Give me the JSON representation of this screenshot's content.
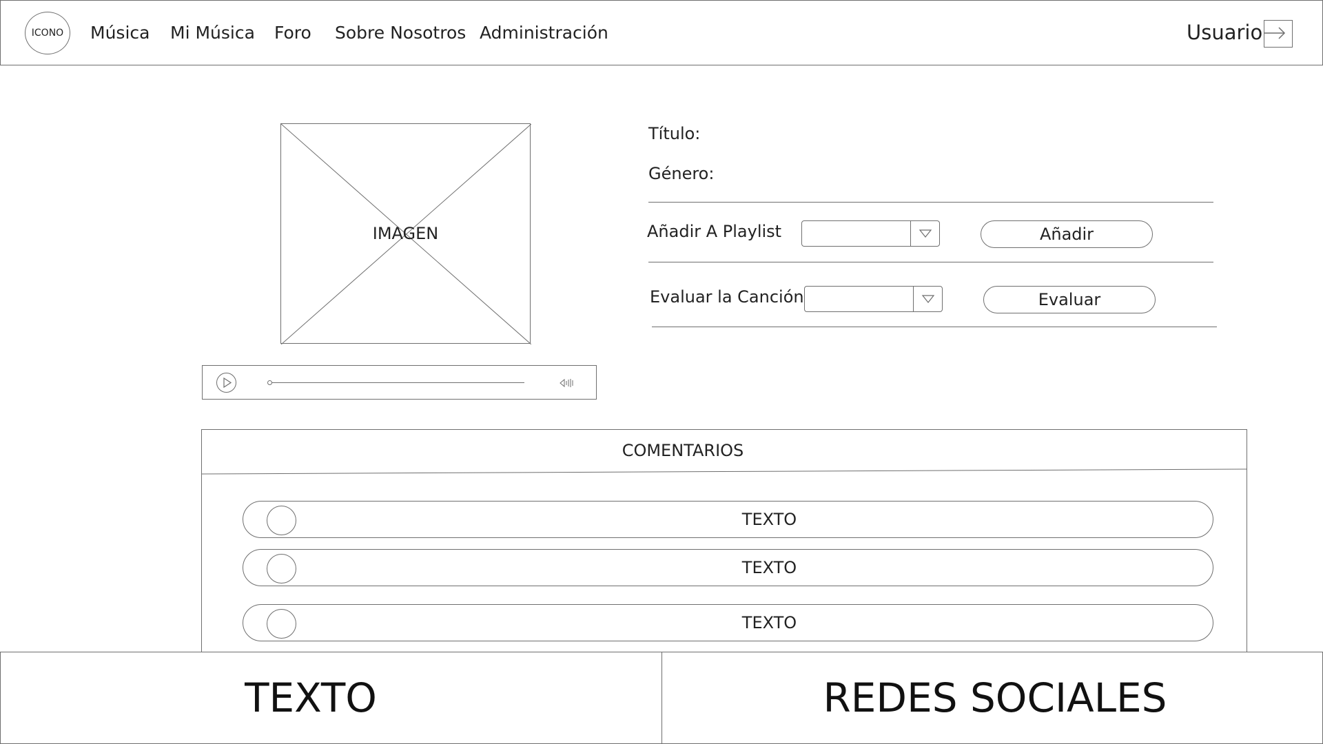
{
  "header": {
    "logo_text": "ICONO",
    "nav": [
      "Música",
      "Mi Música",
      "Foro",
      "Sobre Nosotros",
      "Administración"
    ],
    "user_label": "Usuario",
    "logout_icon": "logout-arrow-icon"
  },
  "media": {
    "image_label": "IMAGEN",
    "player_icons": [
      "play-icon",
      "volume-icon"
    ]
  },
  "song": {
    "title_label": "Título:",
    "genre_label": "Género:",
    "playlist_label": "Añadir A Playlist",
    "playlist_select_value": "",
    "add_button": "Añadir",
    "rate_label": "Evaluar la Canción",
    "rate_select_value": "",
    "rate_button": "Evaluar"
  },
  "comments": {
    "title": "COMENTARIOS",
    "items": [
      {
        "text": "TEXTO"
      },
      {
        "text": "TEXTO"
      },
      {
        "text": "TEXTO"
      }
    ]
  },
  "footer": {
    "left_text": "TEXTO",
    "right_text": "REDES SOCIALES"
  },
  "colors": {
    "line": "#6e6e6e",
    "text": "#222222",
    "background": "#ffffff"
  }
}
